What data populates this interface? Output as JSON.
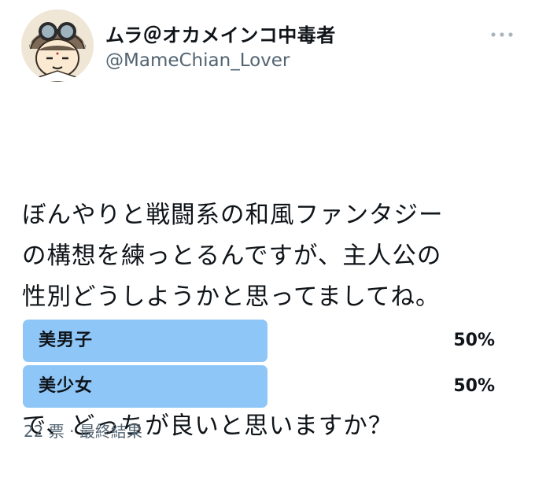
{
  "user": {
    "display_name": "ムラ＠オカメインコ中毒者",
    "handle": "@MameChian_Lover",
    "avatar_icon": "avatar-character-goggles-icon"
  },
  "more_menu": {
    "icon": "more-horizontal-icon"
  },
  "tweet": {
    "paragraph1": "ぼんやりと戦闘系の和風ファンタジー\nの構想を練っとるんですが、主人公の\n性別どうしようかと思ってましてね。",
    "paragraph2": "で、どっちが良いと思いますか？"
  },
  "poll": {
    "options": [
      {
        "label": "美男子",
        "percent": "50%",
        "share": 0.5
      },
      {
        "label": "美少女",
        "percent": "50%",
        "share": 0.5
      }
    ],
    "bar_color": "#8ec6f7",
    "votes": "22 票",
    "separator": "·",
    "status": "最終結果"
  }
}
